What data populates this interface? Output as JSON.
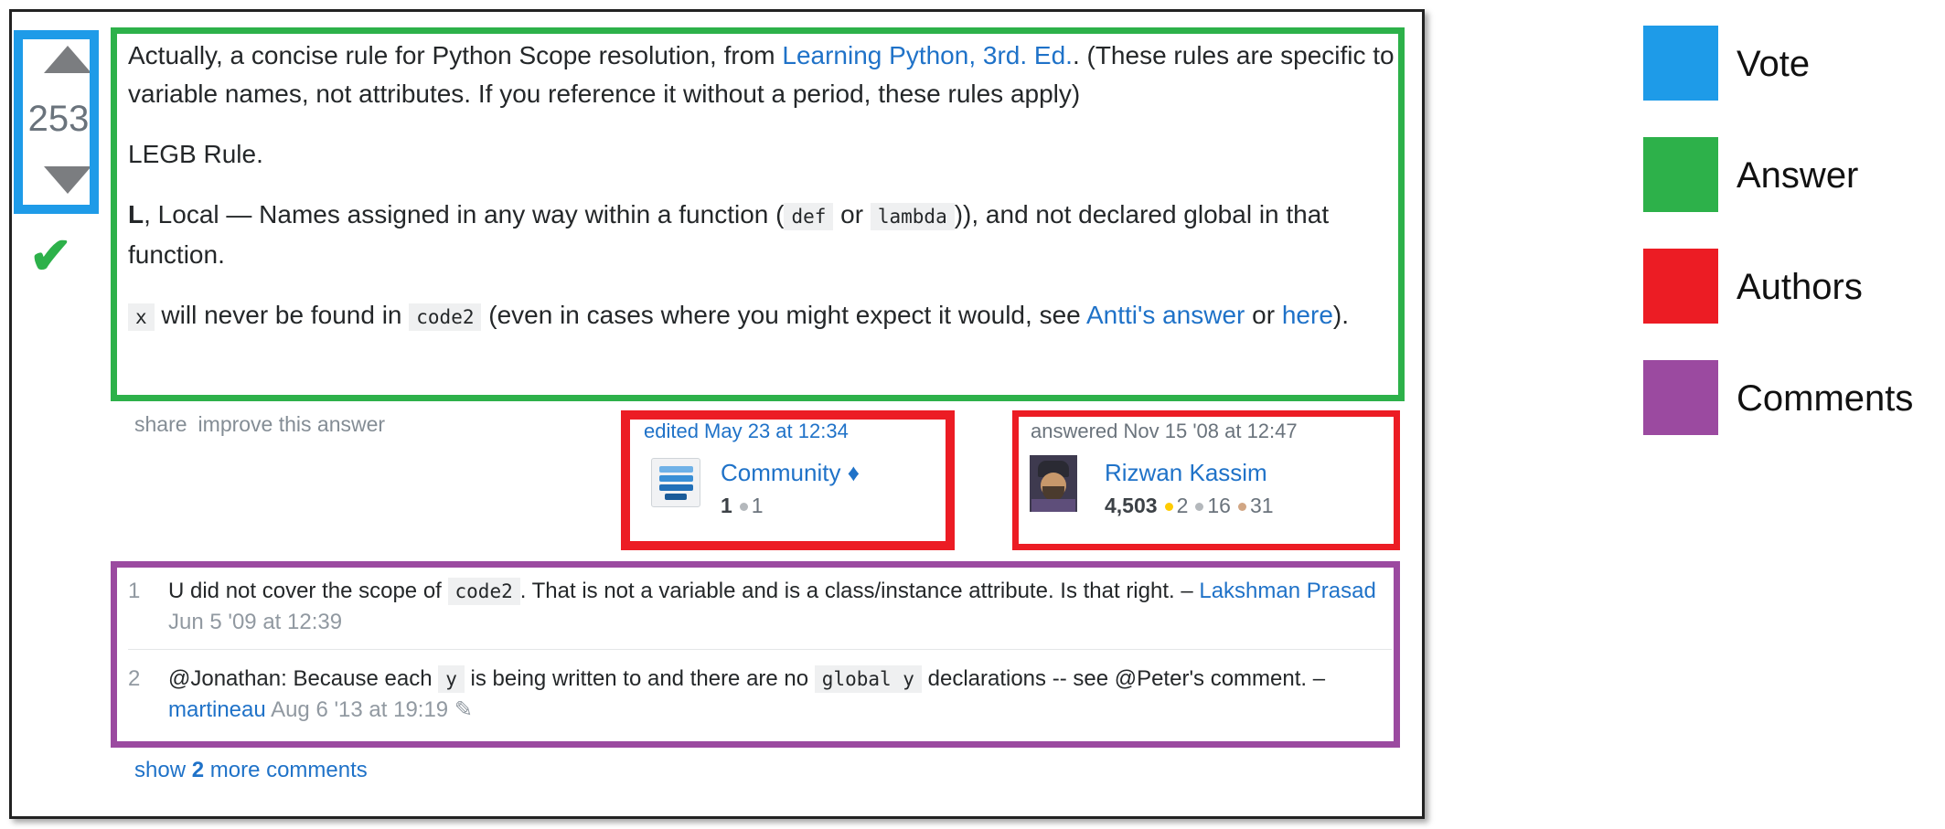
{
  "vote": {
    "count": "253"
  },
  "answer": {
    "p1_a": "Actually, a concise rule for Python Scope resolution, from ",
    "p1_link": "Learning Python, 3rd. Ed.",
    "p1_b": ". (These rules are specific to variable names, not attributes. If you reference it without a period, these rules apply)",
    "p2": "LEGB Rule.",
    "p3_bold": "L",
    "p3_a": ", Local — Names assigned in any way within a function (",
    "p3_code1": "def",
    "p3_mid": " or ",
    "p3_code2": "lambda",
    "p3_b": ")), and not declared global in that function.",
    "p4_code1": "x",
    "p4_a": " will never be found in ",
    "p4_code2": "code2",
    "p4_b": " (even in cases where you might expect it would, see ",
    "p4_link1": "Antti's answer",
    "p4_mid": " or ",
    "p4_link2": "here",
    "p4_c": ")."
  },
  "post_menu": {
    "share": "share",
    "improve": "improve this answer"
  },
  "editor": {
    "action": "edited May 23 at 12:34",
    "name": "Community ♦",
    "rep": "1",
    "bronze": "1"
  },
  "author": {
    "action": "answered Nov 15 '08 at 12:47",
    "name": "Rizwan Kassim",
    "rep": "4,503",
    "gold": "2",
    "silver": "16",
    "bronze": "31"
  },
  "comments": [
    {
      "num": "1",
      "text_a": "U did not cover the scope of ",
      "code": "code2",
      "text_b": ". That is not a variable and is a class/instance attribute. Is that right. – ",
      "user": "Lakshman Prasad",
      "date": "Jun 5 '09 at 12:39"
    },
    {
      "num": "2",
      "text_a": "@Jonathan: Because each ",
      "code1": "y",
      "text_b": " is being written to and there are no ",
      "code2": "global y",
      "text_c": " declarations -- see @Peter's comment. – ",
      "user": "martineau",
      "date": "Aug 6 '13 at 19:19"
    }
  ],
  "show_more": {
    "prefix": "show ",
    "count": "2",
    "suffix": " more comments"
  },
  "legend": [
    {
      "label": "Vote",
      "color": "#1e9be8"
    },
    {
      "label": "Answer",
      "color": "#2db14a"
    },
    {
      "label": "Authors",
      "color": "#ec1c24"
    },
    {
      "label": "Comments",
      "color": "#9b4aa0"
    }
  ],
  "colors": {
    "link": "#1f72c8",
    "badge_gold": "#ffcc01",
    "badge_silver": "#b4b8bc",
    "badge_bronze": "#d1a684"
  }
}
